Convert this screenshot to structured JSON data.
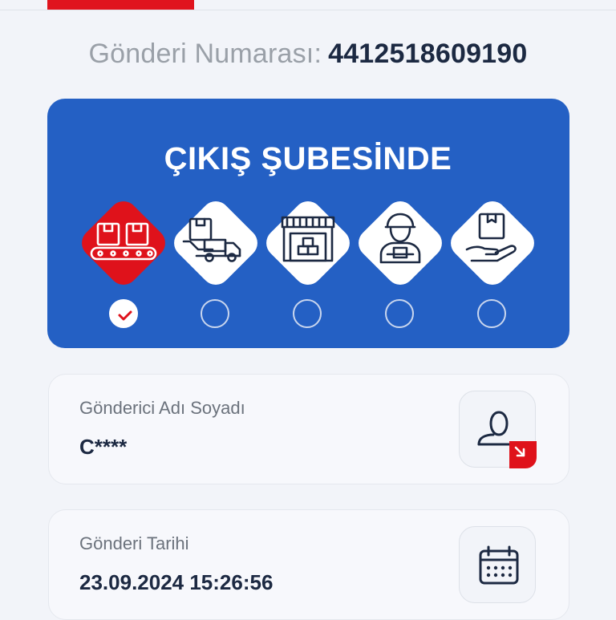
{
  "shipment": {
    "label": "Gönderi Numarası:",
    "number": "4412518609190"
  },
  "status": {
    "title": "ÇIKIŞ ŞUBESİNDE",
    "steps": [
      {
        "icon": "conveyor-boxes-icon",
        "state": "completed"
      },
      {
        "icon": "delivery-truck-icon",
        "state": "pending"
      },
      {
        "icon": "warehouse-icon",
        "state": "pending"
      },
      {
        "icon": "courier-icon",
        "state": "pending"
      },
      {
        "icon": "package-in-hand-icon",
        "state": "pending"
      }
    ]
  },
  "sender": {
    "label": "Gönderici Adı Soyadı",
    "value": "C****",
    "icon": "user-arrow-icon"
  },
  "date": {
    "label": "Gönderi Tarihi",
    "value": "23.09.2024 15:26:56",
    "icon": "calendar-icon"
  },
  "colors": {
    "brand_red": "#e0141e",
    "status_blue": "#2460c4",
    "text_dark": "#1c2942"
  }
}
